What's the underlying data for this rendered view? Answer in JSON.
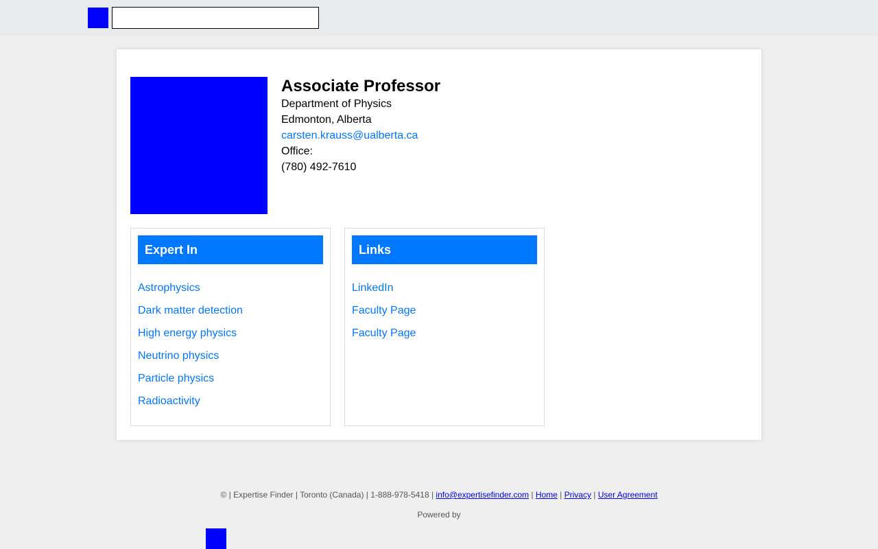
{
  "header": {
    "logo_icon": "expertise-finder-logo",
    "search": {
      "value": "",
      "placeholder": ""
    }
  },
  "profile": {
    "photo_icon": "profile-photo",
    "title": "Associate Professor",
    "department": "Department of Physics",
    "location": "Edmonton, Alberta",
    "email": "carsten.krauss@ualberta.ca",
    "office_label": "Office:",
    "phone": "(780) 492-7610"
  },
  "expert_in": {
    "heading": "Expert In",
    "items": [
      "Astrophysics",
      "Dark matter detection",
      "High energy physics",
      "Neutrino physics",
      "Particle physics",
      "Radioactivity"
    ]
  },
  "links": {
    "heading": "Links",
    "items": [
      "LinkedIn",
      "Faculty Page",
      "Faculty Page"
    ]
  },
  "footer": {
    "prefix": "© | Expertise Finder | Toronto (Canada) | 1-888-978-5418 | ",
    "email": "info@expertisefinder.com",
    "sep": " | ",
    "home": "Home",
    "privacy": "Privacy",
    "agreement": "User Agreement",
    "powered_by": "Powered by"
  },
  "colors": {
    "accent": "#0077ff",
    "logo": "#0000ff",
    "topbar": "#e8ebee",
    "background": "#efefef"
  }
}
